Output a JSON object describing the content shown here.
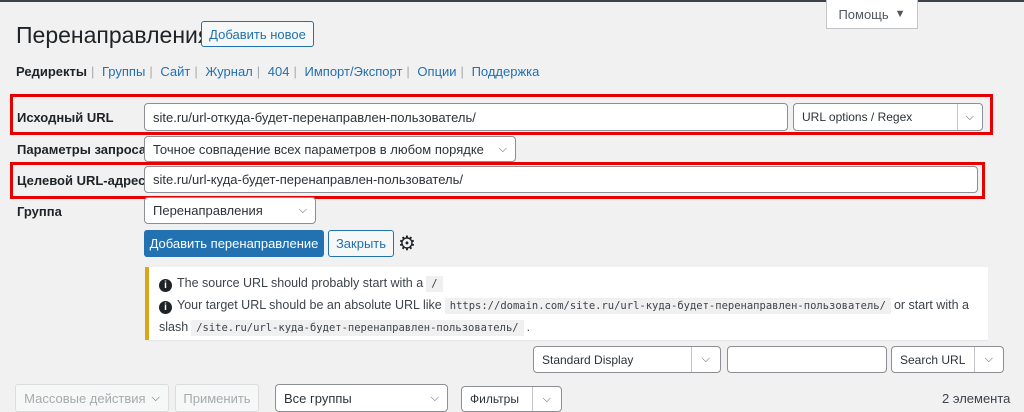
{
  "header": {
    "title": "Перенаправления",
    "add_new": "Добавить новое",
    "help": "Помощь"
  },
  "subnav": [
    {
      "label": "Редиректы",
      "current": true
    },
    {
      "label": "Группы"
    },
    {
      "label": "Сайт"
    },
    {
      "label": "Журнал"
    },
    {
      "label": "404"
    },
    {
      "label": "Импорт/Экспорт"
    },
    {
      "label": "Опции"
    },
    {
      "label": "Поддержка"
    }
  ],
  "form": {
    "source_label": "Исходный URL",
    "source_value": "site.ru/url-откуда-будет-перенаправлен-пользователь/",
    "url_options": "URL options / Regex",
    "query_label": "Параметры запроса",
    "query_value": "Точное совпадение всех параметров в любом порядке",
    "target_label": "Целевой URL-адрес",
    "target_value": "site.ru/url-куда-будет-перенаправлен-пользователь/",
    "group_label": "Группа",
    "group_value": "Перенаправления",
    "add_button": "Добавить перенаправление",
    "close_button": "Закрыть"
  },
  "notice": {
    "line1": "The source URL should probably start with a",
    "line1_code": "/",
    "line2_a": "Your target URL should be an absolute URL like",
    "line2_code": "https://domain.com/site.ru/url-куда-будет-перенаправлен-пользователь/",
    "line2_b": "or start with a slash",
    "line2_code2": "/site.ru/url-куда-будет-перенаправлен-пользователь/",
    "line2_end": "."
  },
  "search": {
    "display": "Standard Display",
    "query": "",
    "search_button": "Search URL"
  },
  "table_nav": {
    "bulk": "Массовые действия",
    "apply": "Применить",
    "groups": "Все группы",
    "filters": "Фильтры",
    "count": "2 элемента"
  }
}
